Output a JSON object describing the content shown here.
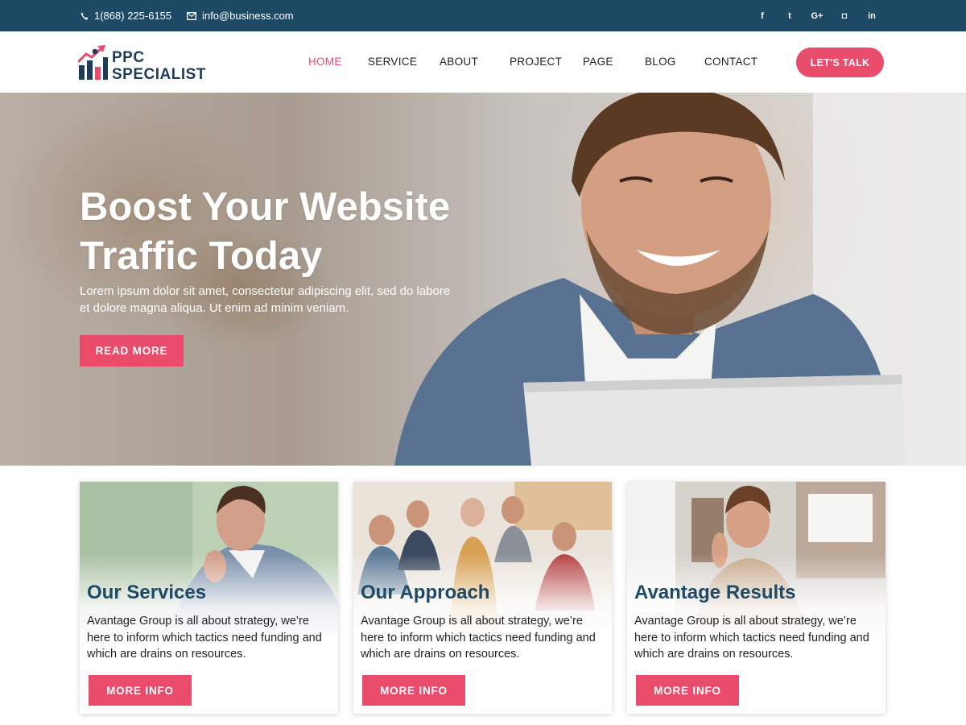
{
  "topbar": {
    "phone": "1(868) 225-6155",
    "email": "info@business.com",
    "socials": [
      {
        "icon": "facebook-icon",
        "glyph": "f"
      },
      {
        "icon": "twitter-icon",
        "glyph": "t"
      },
      {
        "icon": "google-plus-icon",
        "glyph": "G+"
      },
      {
        "icon": "instagram-icon",
        "glyph": "◘"
      },
      {
        "icon": "linkedin-icon",
        "glyph": "in"
      }
    ]
  },
  "header": {
    "logo_line1": "PPC",
    "logo_line2": "SPECIALIST",
    "nav": [
      "HOME",
      "SERVICE",
      "ABOUT",
      "PROJECT",
      "PAGE",
      "BLOG",
      "CONTACT"
    ],
    "active_nav": "HOME",
    "cta_label": "LET'S TALK"
  },
  "hero": {
    "title_line1": "Boost Your Website",
    "title_line2": "Traffic Today",
    "subtitle": "Lorem ipsum dolor sit amet, consectetur adipiscing elit, sed do labore et dolore magna aliqua. Ut enim ad minim veniam.",
    "button_label": "READ MORE"
  },
  "cards": [
    {
      "title": "Our Services",
      "text": "Avantage Group is all about strategy, we’re here to inform which tactics need funding and which are drains on resources.",
      "button_label": "MORE INFO"
    },
    {
      "title": "Our Approach",
      "text": "Avantage Group is all about strategy, we’re here to inform which tactics need funding and which are drains on resources.",
      "button_label": "MORE INFO"
    },
    {
      "title": "Avantage Results",
      "text": "Avantage Group is all about strategy, we’re here to inform which tactics need funding and which are drains on resources.",
      "button_label": "MORE INFO"
    }
  ],
  "colors": {
    "topbar": "#1e4a66",
    "accent": "#e94b6a",
    "heading": "#1e4a66"
  }
}
